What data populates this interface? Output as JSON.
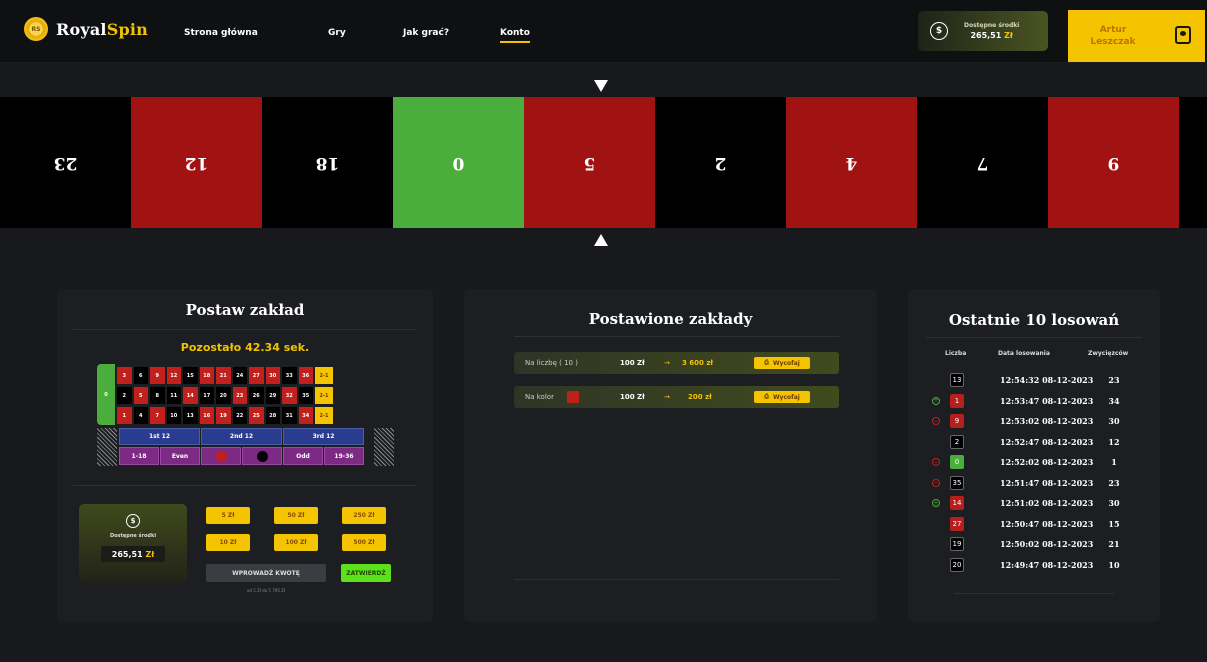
{
  "colors": {
    "accent": "#f2c400",
    "red": "#a11313",
    "green": "#4bae3c",
    "black": "#000000"
  },
  "brand": {
    "royal": "Royal",
    "spin": "Spin",
    "chip_text": "RS"
  },
  "nav": [
    {
      "label": "Strona główna",
      "active": false
    },
    {
      "label": "Gry",
      "active": false
    },
    {
      "label": "Jak grać?",
      "active": false
    },
    {
      "label": "Konto",
      "active": true
    }
  ],
  "header": {
    "funds_label": "Dostępne środki",
    "funds_value": "265,51",
    "currency": "Zł",
    "user_first": "Artur",
    "user_last": "Leszczak",
    "funds_icon": "dollar-coin-icon",
    "user_icon": "user-badge-icon"
  },
  "wheel": [
    {
      "num": "23",
      "color": "black"
    },
    {
      "num": "12",
      "color": "red"
    },
    {
      "num": "18",
      "color": "black"
    },
    {
      "num": "0",
      "color": "green"
    },
    {
      "num": "5",
      "color": "red"
    },
    {
      "num": "2",
      "color": "black"
    },
    {
      "num": "4",
      "color": "red"
    },
    {
      "num": "7",
      "color": "black"
    },
    {
      "num": "9",
      "color": "red"
    },
    {
      "num": "",
      "color": "black"
    }
  ],
  "bet_panel": {
    "title": "Postaw zakład",
    "timer": "Pozostało 42.34 sek.",
    "zero": "0",
    "rows": [
      [
        {
          "n": "3",
          "c": "red"
        },
        {
          "n": "6",
          "c": "black"
        },
        {
          "n": "9",
          "c": "red"
        },
        {
          "n": "12",
          "c": "red"
        },
        {
          "n": "15",
          "c": "black"
        },
        {
          "n": "18",
          "c": "red"
        },
        {
          "n": "21",
          "c": "red"
        },
        {
          "n": "24",
          "c": "black"
        },
        {
          "n": "27",
          "c": "red"
        },
        {
          "n": "30",
          "c": "red"
        },
        {
          "n": "33",
          "c": "black"
        },
        {
          "n": "36",
          "c": "red"
        }
      ],
      [
        {
          "n": "2",
          "c": "black"
        },
        {
          "n": "5",
          "c": "red"
        },
        {
          "n": "8",
          "c": "black"
        },
        {
          "n": "11",
          "c": "black"
        },
        {
          "n": "14",
          "c": "red"
        },
        {
          "n": "17",
          "c": "black"
        },
        {
          "n": "20",
          "c": "black"
        },
        {
          "n": "23",
          "c": "red"
        },
        {
          "n": "26",
          "c": "black"
        },
        {
          "n": "29",
          "c": "black"
        },
        {
          "n": "32",
          "c": "red"
        },
        {
          "n": "35",
          "c": "black"
        }
      ],
      [
        {
          "n": "1",
          "c": "red"
        },
        {
          "n": "4",
          "c": "black"
        },
        {
          "n": "7",
          "c": "red"
        },
        {
          "n": "10",
          "c": "black"
        },
        {
          "n": "13",
          "c": "black"
        },
        {
          "n": "16",
          "c": "red"
        },
        {
          "n": "19",
          "c": "red"
        },
        {
          "n": "22",
          "c": "black"
        },
        {
          "n": "25",
          "c": "red"
        },
        {
          "n": "28",
          "c": "black"
        },
        {
          "n": "31",
          "c": "black"
        },
        {
          "n": "34",
          "c": "red"
        }
      ]
    ],
    "columns": [
      "2-1",
      "2-1",
      "2-1"
    ],
    "dozens": [
      "1st 12",
      "2nd 12",
      "3rd 12"
    ],
    "outside": [
      "1-18",
      "Even",
      "",
      "",
      "Odd",
      "19-36"
    ],
    "funds_label": "Dostępne środki",
    "funds_value": "265,51",
    "currency": "Zł",
    "chips": [
      "5 Zł",
      "50 Zł",
      "250 Zł",
      "10 Zł",
      "100 Zł",
      "500 Zł"
    ],
    "enter_amount": "WPROWADŹ KWOTĘ",
    "confirm": "ZATWIERDŹ",
    "hint": "od 5 Zł do 5 795 Zł"
  },
  "placed": {
    "title": "Postawione zakłady",
    "bets": [
      {
        "label": "Na liczbę ( 10 )",
        "stake": "100 Zł",
        "arrow": "→",
        "win": "3 600 zł",
        "withdraw": "Wycofaj"
      },
      {
        "label": "Na kolor",
        "stake": "100 Zł",
        "arrow": "→",
        "win": "200 zł",
        "withdraw": "Wycofaj"
      }
    ]
  },
  "history": {
    "title": "Ostatnie 10 losowań",
    "headers": [
      "Liczba",
      "Data losowania",
      "Zwycięzców"
    ],
    "rows": [
      {
        "num": "13",
        "color": "black",
        "status": "",
        "date": "12:54:32 08-12-2023",
        "winners": "23"
      },
      {
        "num": "1",
        "color": "red",
        "status": "win",
        "date": "12:53:47 08-12-2023",
        "winners": "34"
      },
      {
        "num": "9",
        "color": "red",
        "status": "lose",
        "date": "12:53:02 08-12-2023",
        "winners": "30"
      },
      {
        "num": "2",
        "color": "black",
        "status": "",
        "date": "12:52:47 08-12-2023",
        "winners": "12"
      },
      {
        "num": "0",
        "color": "green",
        "status": "lose",
        "date": "12:52:02 08-12-2023",
        "winners": "1"
      },
      {
        "num": "35",
        "color": "black",
        "status": "lose",
        "date": "12:51:47 08-12-2023",
        "winners": "23"
      },
      {
        "num": "14",
        "color": "red",
        "status": "win",
        "date": "12:51:02 08-12-2023",
        "winners": "30"
      },
      {
        "num": "27",
        "color": "red",
        "status": "",
        "date": "12:50:47 08-12-2023",
        "winners": "15"
      },
      {
        "num": "19",
        "color": "black",
        "status": "",
        "date": "12:50:02 08-12-2023",
        "winners": "21"
      },
      {
        "num": "20",
        "color": "black",
        "status": "",
        "date": "12:49:47 08-12-2023",
        "winners": "10"
      }
    ]
  }
}
